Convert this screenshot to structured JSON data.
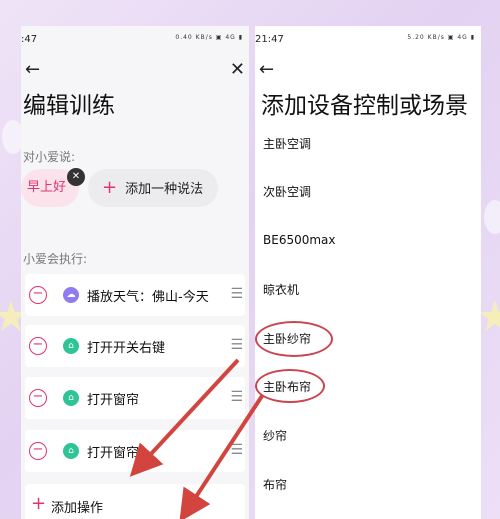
{
  "left": {
    "status_time": ":47",
    "status_icons": "0.40 KB/s ▣ 4G ▮",
    "title": "编辑训练",
    "say_label": "对小爱说:",
    "phrase": "早上好",
    "add_phrase": "添加一种说法",
    "exec_label": "小爱会执行:",
    "actions": [
      {
        "label": "播放天气：佛山-今天",
        "icon": "weather-icon"
      },
      {
        "label": "打开开关右键",
        "icon": "home-icon"
      },
      {
        "label": "打开窗帘",
        "icon": "home-icon"
      },
      {
        "label": "打开窗帘",
        "icon": "home-icon"
      }
    ],
    "add_action": "添加操作"
  },
  "right": {
    "status_time": "21:47",
    "status_icons": "5.20 KB/s ▣ 4G ▮",
    "title": "添加设备控制或场景",
    "devices": [
      "主卧空调",
      "次卧空调",
      "BE6500max",
      "晾衣机",
      "主卧纱帘",
      "主卧布帘",
      "纱帘",
      "布帘"
    ]
  },
  "colors": {
    "accent": "#e0356a",
    "annotation": "#c8464f"
  }
}
